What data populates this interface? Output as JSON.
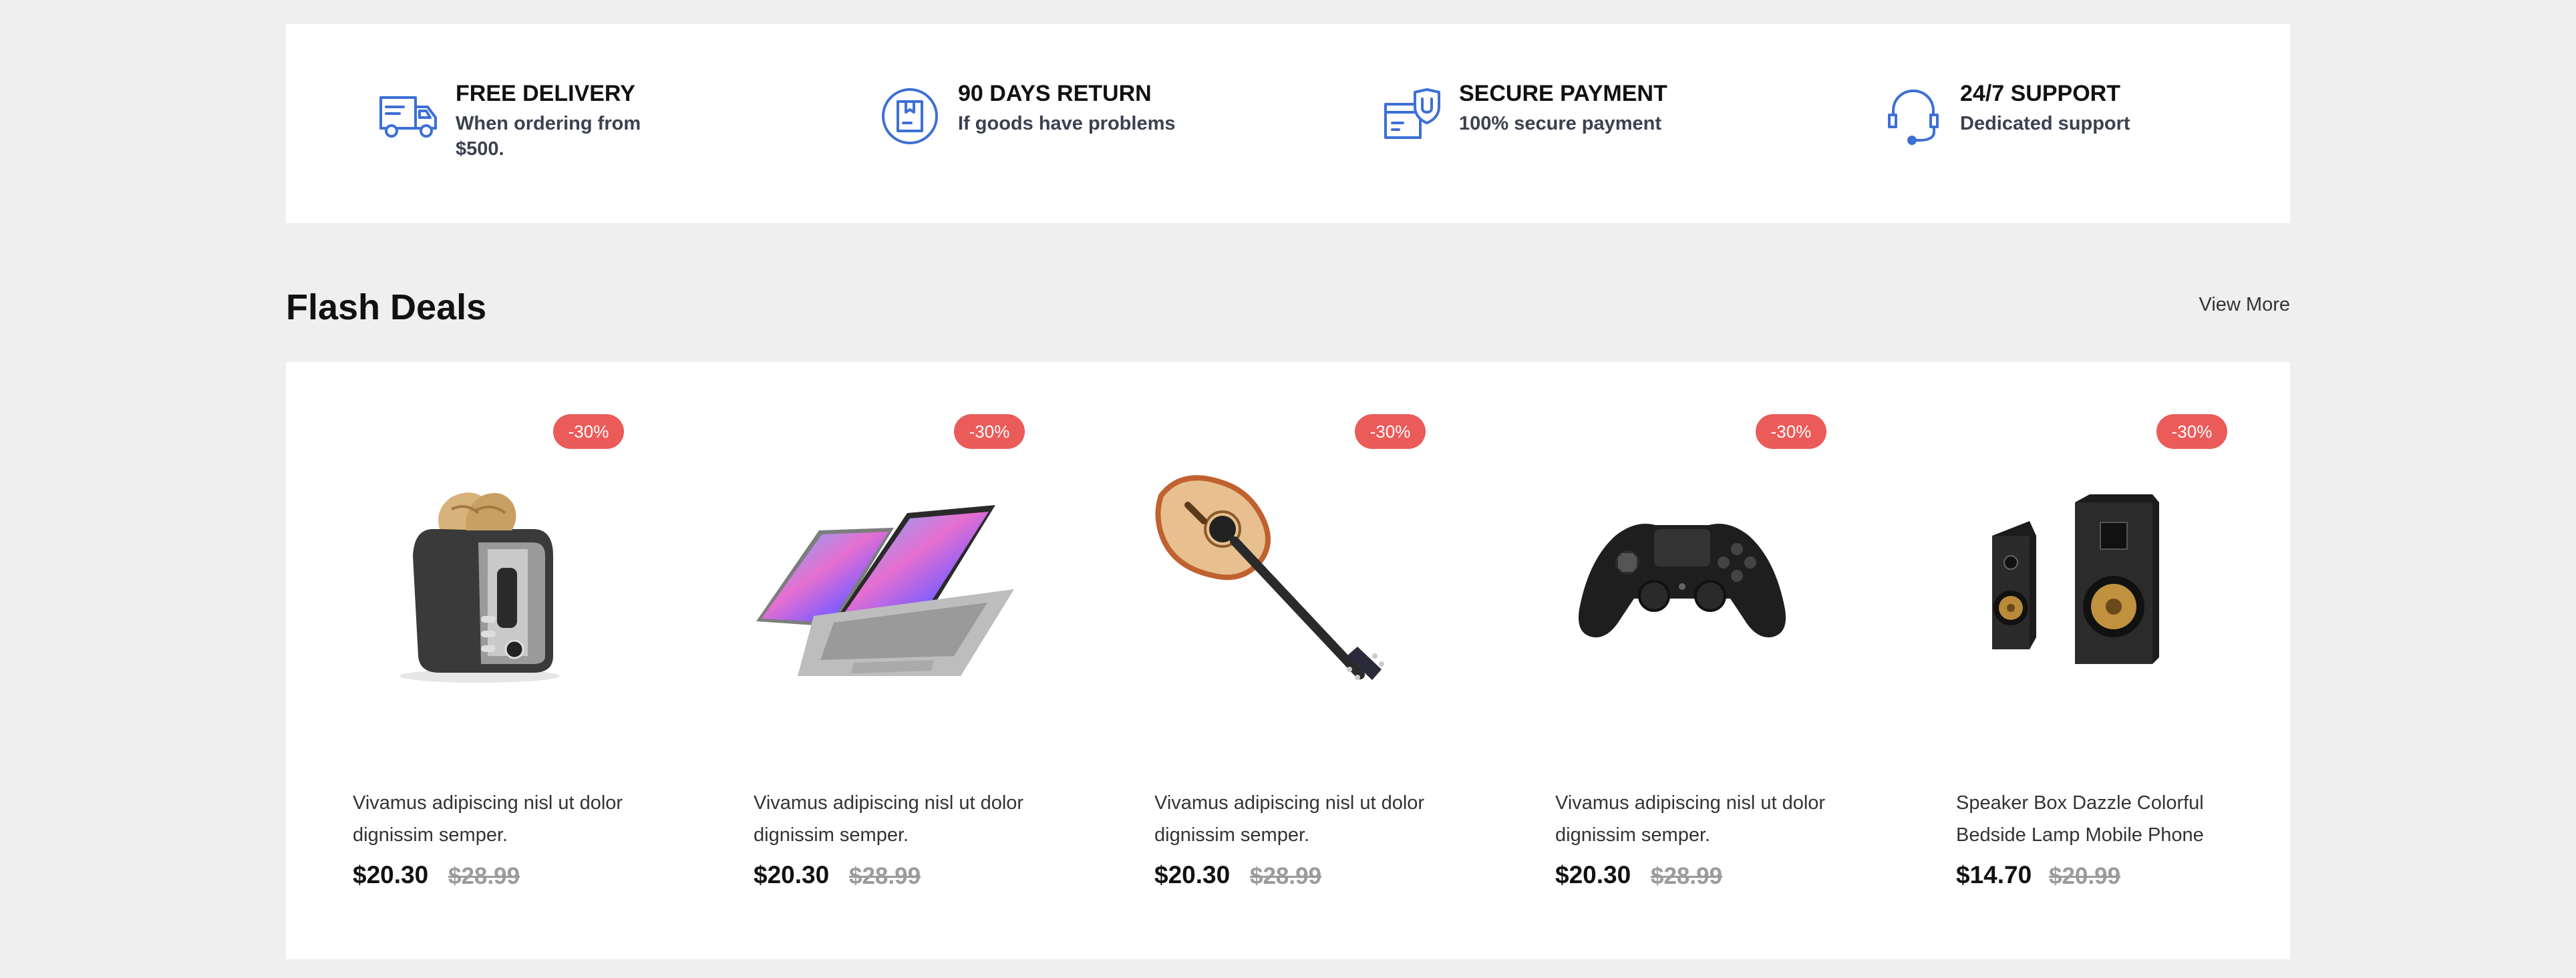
{
  "features": [
    {
      "icon": "delivery-truck-icon",
      "title": "FREE DELIVERY",
      "desc": "When ordering from $500."
    },
    {
      "icon": "return-box-icon",
      "title": "90 DAYS RETURN",
      "desc": "If goods have problems"
    },
    {
      "icon": "secure-card-icon",
      "title": "SECURE PAYMENT",
      "desc": "100% secure payment"
    },
    {
      "icon": "headset-icon",
      "title": "24/7 SUPPORT",
      "desc": "Dedicated support"
    }
  ],
  "flash_deals": {
    "title": "Flash Deals",
    "view_more": "View More",
    "products": [
      {
        "image": "toaster-image",
        "badge": "-30%",
        "name": "Vivamus adipiscing nisl ut dolor dignissim semper.",
        "price": "$20.30",
        "old_price": "$28.99"
      },
      {
        "image": "laptop-image",
        "badge": "-30%",
        "name": "Vivamus adipiscing nisl ut dolor dignissim semper.",
        "price": "$20.30",
        "old_price": "$28.99"
      },
      {
        "image": "guitar-image",
        "badge": "-30%",
        "name": "Vivamus adipiscing nisl ut dolor dignissim semper.",
        "price": "$20.30",
        "old_price": "$28.99"
      },
      {
        "image": "gamepad-image",
        "badge": "-30%",
        "name": "Vivamus adipiscing nisl ut dolor dignissim semper.",
        "price": "$20.30",
        "old_price": "$28.99"
      },
      {
        "image": "speakers-image",
        "badge": "-30%",
        "name": "Speaker Box Dazzle Colorful Bedside Lamp Mobile Phone",
        "price": "$14.70",
        "old_price": "$20.99"
      }
    ]
  },
  "colors": {
    "accent_icon": "#3d6fd6",
    "badge": "#ea5b59",
    "old_price": "#9b9b9b",
    "background": "#efefef"
  }
}
